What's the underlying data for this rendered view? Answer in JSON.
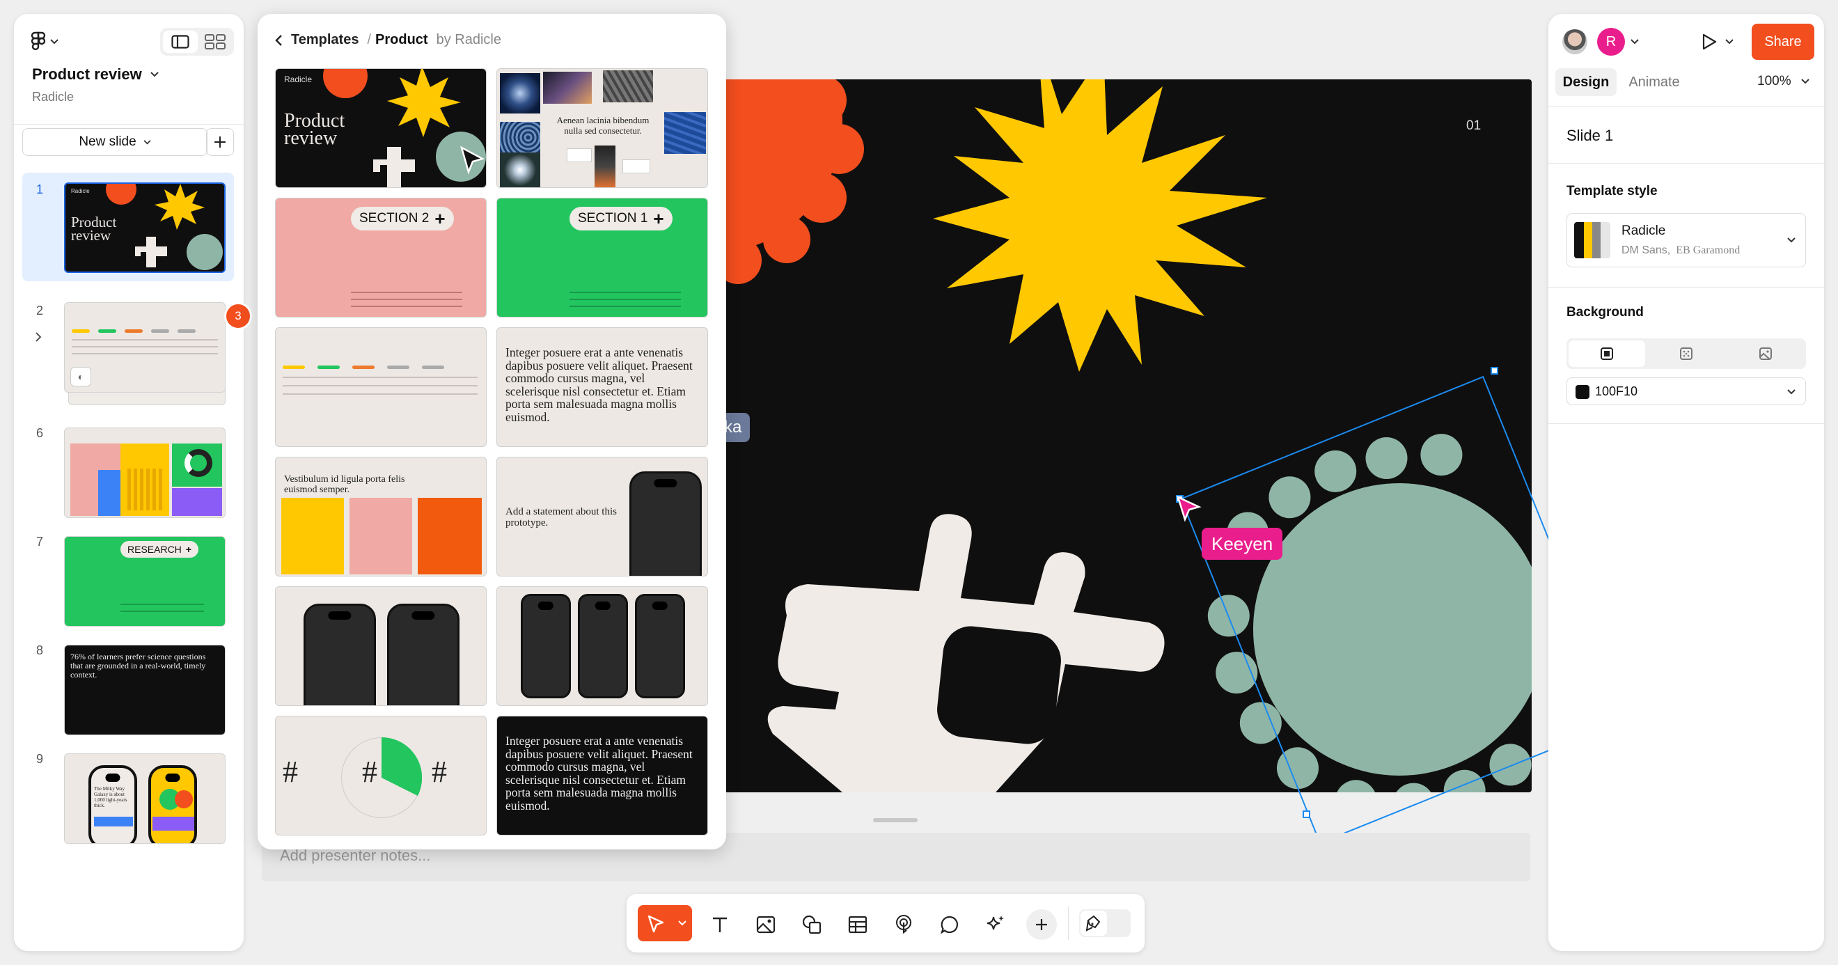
{
  "left_panel": {
    "file_title": "Product review",
    "team": "Radicle",
    "new_slide_label": "New slide",
    "slide_numbers": [
      "1",
      "2",
      "6",
      "7",
      "8",
      "9"
    ],
    "comment_count": "3",
    "thumb1_text": "Product\nreview",
    "thumb1_brand": "Radicle",
    "thumb7_label": "RESEARCH",
    "thumb8_text": "76% of learners prefer science questions that are grounded in a real-world, timely context.",
    "thumb9_text": "The Milky Way Galaxy is about 1,000 light-years thick."
  },
  "templates": {
    "breadcrumb_root": "Templates",
    "separator": "/",
    "current": "Product",
    "author": "by Radicle",
    "cards": {
      "c1_title": "Product\nreview",
      "c1_brand": "Radicle",
      "c2_text": "Aenean lacinia bibendum nulla sed consectetur.",
      "c3_label": "SECTION 2",
      "c4_label": "SECTION 1",
      "c6_text": "Integer posuere erat a ante venenatis dapibus posuere velit aliquet. Praesent commodo cursus magna, vel scelerisque nisl consectetur et. Etiam porta sem malesuada magna mollis euismod.",
      "c7_text": "Vestibulum id ligula porta felis euismod semper.",
      "c8_text": "Add a statement about this prototype.",
      "c11_hash": "#",
      "c12_text": "Integer posuere erat a ante venenatis dapibus posuere velit aliquet. Praesent commodo cursus magna, vel scelerisque nisl consectetur et. Etiam porta sem malesuada magna mollis euismod."
    }
  },
  "canvas": {
    "slide_number": "01",
    "cursor_other": "ka",
    "cursor_keeyen": "Keeyen",
    "notes_placeholder": "Add presenter notes..."
  },
  "toolbar": {
    "tools": [
      "move-tool",
      "text-tool",
      "image-tool",
      "shape-tool",
      "table-tool",
      "interaction-tool",
      "comment-tool",
      "ai-tool",
      "more-tool",
      "draw-tool"
    ]
  },
  "right_panel": {
    "avatar_initial": "R",
    "share_label": "Share",
    "tabs": [
      "Design",
      "Animate"
    ],
    "zoom": "100%",
    "slide_name": "Slide 1",
    "template_style_label": "Template style",
    "template_name": "Radicle",
    "template_font1": "DM Sans,",
    "template_font2": "EB Garamond",
    "background_label": "Background",
    "background_hex": "100F10"
  },
  "colors": {
    "accent": "#F24E1E",
    "slide_bg": "#100F10",
    "yellow": "#FFC800",
    "sage": "#8FB5A6",
    "cream": "#F0EBE6",
    "pink_cursor": "#E91E8C",
    "green": "#22C55E",
    "pink_card": "#F0A9A4"
  }
}
